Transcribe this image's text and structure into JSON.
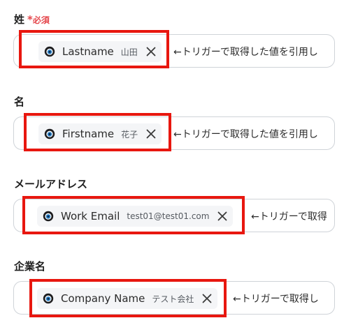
{
  "fields": [
    {
      "label": "姓",
      "required_star": "*",
      "required_text": "必須",
      "chip_name": "Lastname",
      "chip_value": "山田",
      "chip_icon": "circle-logo-icon",
      "hint": "←トリガーで取得した値を引用し"
    },
    {
      "label": "名",
      "chip_name": "Firstname",
      "chip_value": "花子",
      "chip_icon": "circle-logo-icon",
      "hint": "←トリガーで取得した値を引用し"
    },
    {
      "label": "メールアドレス",
      "chip_name": "Work Email",
      "chip_value": "test01@test01.com",
      "chip_icon": "circle-logo-icon",
      "hint": "←トリガーで取得"
    },
    {
      "label": "企業名",
      "chip_name": "Company Name",
      "chip_value": "テスト会社",
      "chip_icon": "circle-logo-icon",
      "hint": "←トリガーで取得し"
    }
  ],
  "colors": {
    "required": "#e5484d",
    "highlight_border": "#e8170f",
    "field_border": "#cfd3d8",
    "chip_bg": "#f4f5f7"
  }
}
